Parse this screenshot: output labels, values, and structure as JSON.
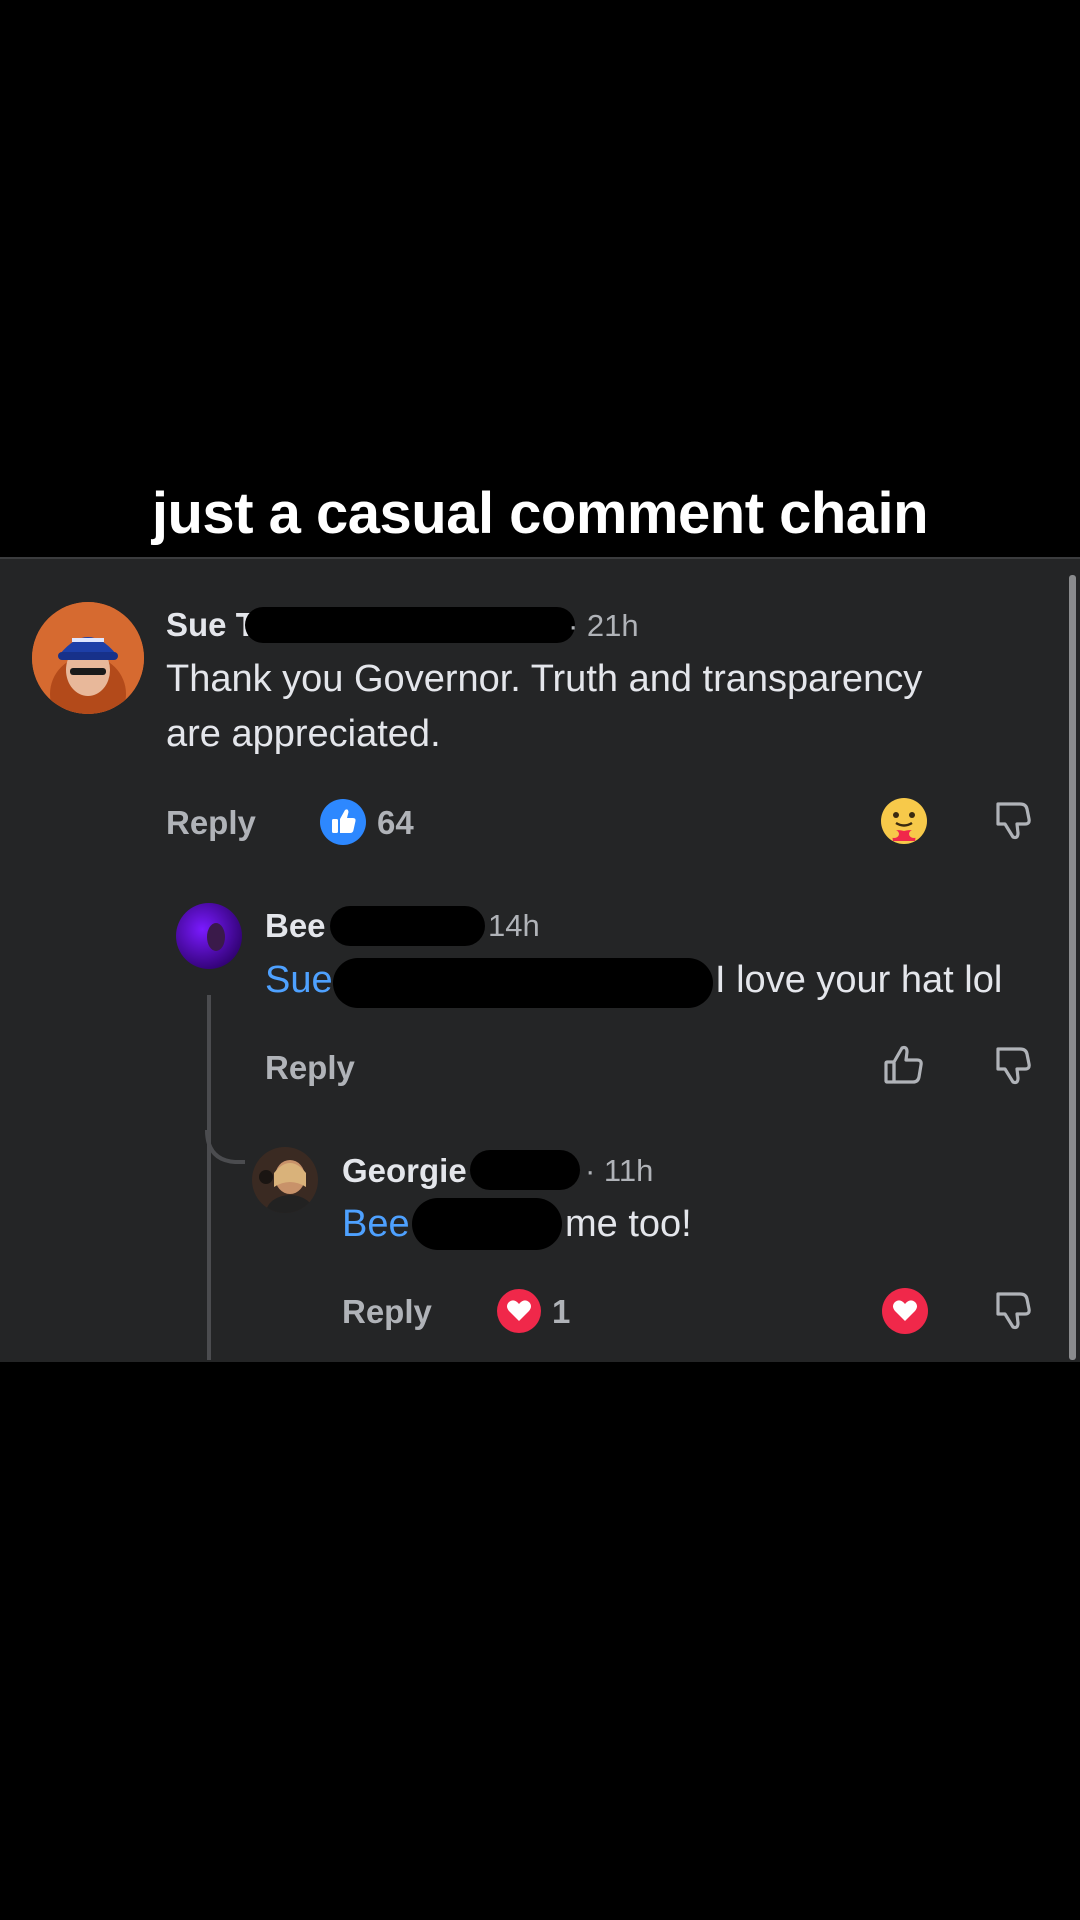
{
  "caption": "just a casual comment chain",
  "comments": [
    {
      "author": "Sue",
      "author_suffix": "T",
      "time": "· 21h",
      "text_line1": "Thank you Governor. Truth and transparency",
      "text_line2": "are appreciated.",
      "reply_label": "Reply",
      "reaction_count": "64",
      "reaction_icon": "like-reaction-icon",
      "my_reaction_icon": "care-emoji-icon"
    },
    {
      "author": "Bee",
      "time": "14h",
      "mention": "Sue",
      "text": "I love your hat lol",
      "reply_label": "Reply"
    },
    {
      "author": "Georgie",
      "time": "· 11h",
      "mention": "Bee",
      "text": "me too!",
      "reply_label": "Reply",
      "reaction_count": "1",
      "reaction_icon": "love-reaction-icon",
      "my_reaction_icon": "love-reaction-icon"
    }
  ],
  "colors": {
    "panel": "#242526",
    "mention": "#4ea1ff",
    "like_blue": "#2d88ff",
    "love_red": "#f0284a"
  }
}
